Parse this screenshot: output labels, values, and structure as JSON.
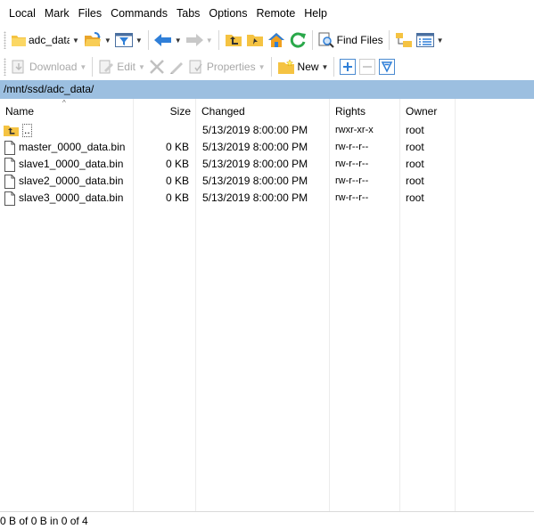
{
  "menu": [
    "Local",
    "Mark",
    "Files",
    "Commands",
    "Tabs",
    "Options",
    "Remote",
    "Help"
  ],
  "toolbar1": {
    "drive": "adc_data",
    "find_files": "Find Files"
  },
  "toolbar2": {
    "download": "Download",
    "edit": "Edit",
    "properties": "Properties",
    "new": "New"
  },
  "path": "/mnt/ssd/adc_data/",
  "columns": {
    "name": "Name",
    "size": "Size",
    "changed": "Changed",
    "rights": "Rights",
    "owner": "Owner"
  },
  "parent_row": {
    "name": "..",
    "changed": "5/13/2019 8:00:00 PM",
    "rights": "rwxr-xr-x",
    "owner": "root"
  },
  "files": [
    {
      "name": "master_0000_data.bin",
      "size": "0 KB",
      "changed": "5/13/2019 8:00:00 PM",
      "rights": "rw-r--r--",
      "owner": "root"
    },
    {
      "name": "slave1_0000_data.bin",
      "size": "0 KB",
      "changed": "5/13/2019 8:00:00 PM",
      "rights": "rw-r--r--",
      "owner": "root"
    },
    {
      "name": "slave2_0000_data.bin",
      "size": "0 KB",
      "changed": "5/13/2019 8:00:00 PM",
      "rights": "rw-r--r--",
      "owner": "root"
    },
    {
      "name": "slave3_0000_data.bin",
      "size": "0 KB",
      "changed": "5/13/2019 8:00:00 PM",
      "rights": "rw-r--r--",
      "owner": "root"
    }
  ],
  "status": "0 B of 0 B in 0 of 4",
  "colors": {
    "path_bar": "#9cbfe0",
    "folder": "#f5c342",
    "arrow_blue": "#2f7fd8",
    "refresh_green": "#2aa84a"
  }
}
